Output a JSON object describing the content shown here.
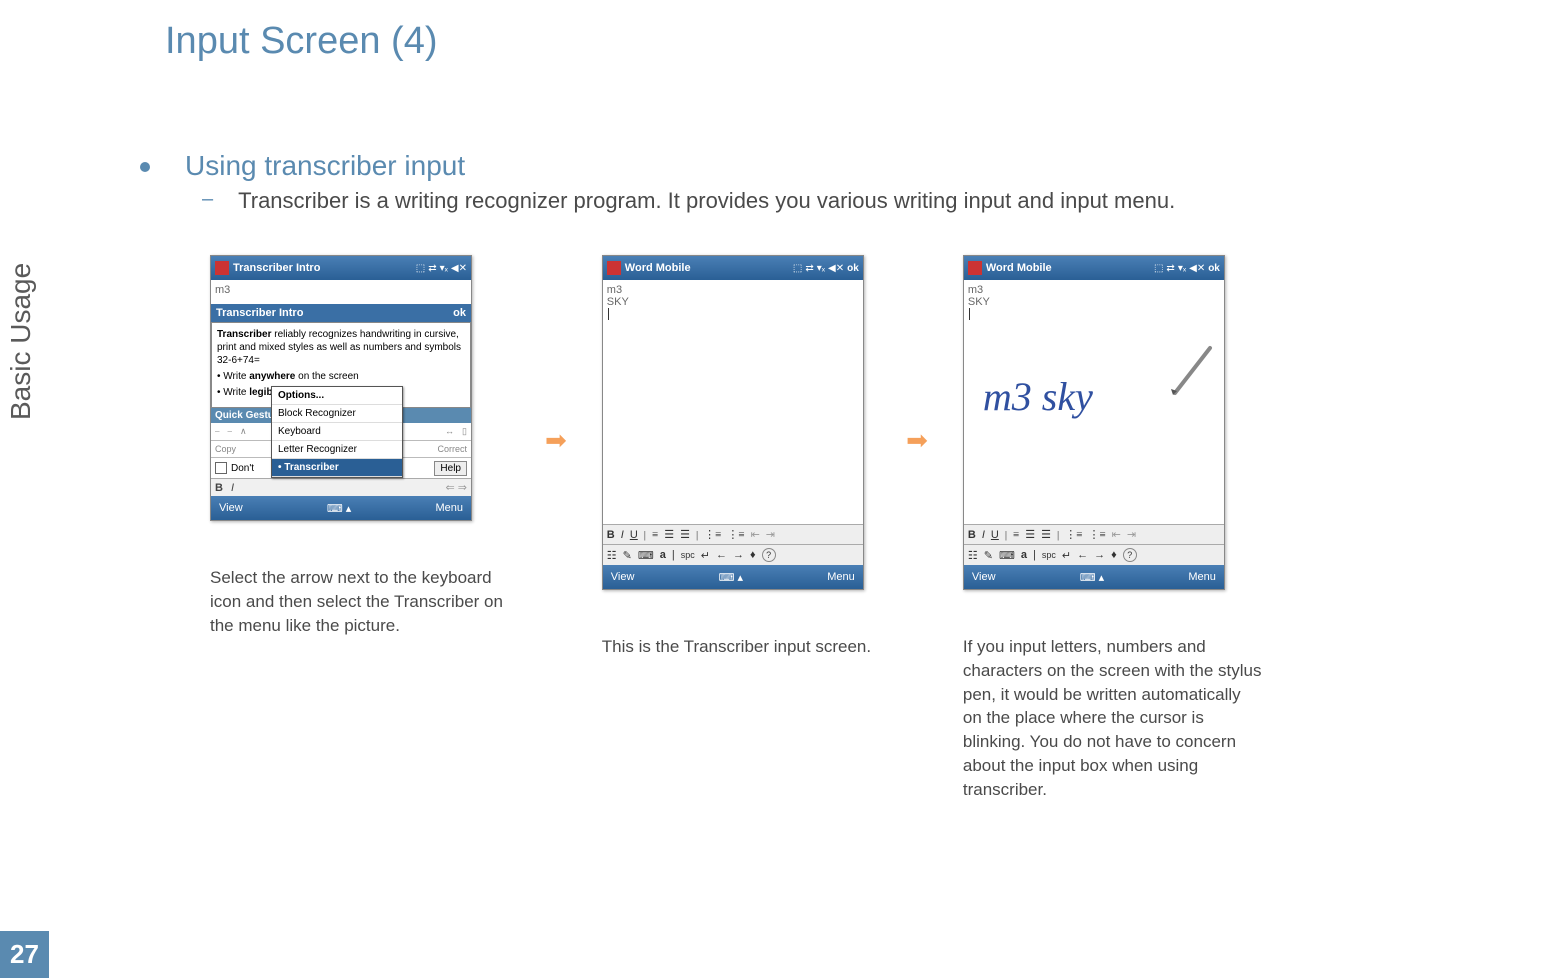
{
  "page": {
    "title": "Input Screen (4)",
    "section_label": "Basic Usage",
    "page_number": "27"
  },
  "bullets": {
    "main": "Using transcriber input",
    "sub": "Transcriber is a writing recognizer program. It provides you various writing input and input menu."
  },
  "screenshots": {
    "s1": {
      "title": "Transcriber Intro",
      "status_ok": "ok",
      "body_top": "m3",
      "intro_title": "Transcriber Intro",
      "intro_text_bold": "Transcriber",
      "intro_text_rest": " reliably recognizes handwriting in cursive, print and mixed styles as well as numbers and symbols 32-6+74=",
      "intro_tip1_pre": "Write ",
      "intro_tip1_bold": "anywhere",
      "intro_tip1_post": " on the screen",
      "intro_tip2_pre": "Write ",
      "intro_tip2_bold": "legibly",
      "quick_title": "Quick Gestures",
      "gest_copy": "Copy",
      "gest_correct": "Correct",
      "dont": "Don't",
      "help_label": "Help",
      "menu": {
        "options": "Options...",
        "block": "Block Recognizer",
        "keyboard": "Keyboard",
        "letter": "Letter Recognizer",
        "transcriber": "Transcriber"
      },
      "bi_b": "B",
      "bi_i": "I",
      "bot_view": "View",
      "bot_menu": "Menu",
      "caption": "Select the arrow next to the keyboard icon and then select the Transcriber on the menu like the picture."
    },
    "s2": {
      "title": "Word Mobile",
      "status_ok": "ok",
      "body_line1": "m3",
      "body_line2": "SKY",
      "fmt_b": "B",
      "fmt_i": "I",
      "fmt_u": "U",
      "trans_a": "a",
      "trans_spc": "spc",
      "help_q": "?",
      "bot_view": "View",
      "bot_menu": "Menu",
      "caption": "This is the Transcriber input screen."
    },
    "s3": {
      "title": "Word Mobile",
      "status_ok": "ok",
      "body_line1": "m3",
      "body_line2": "SKY",
      "handwritten": "m3 sky",
      "fmt_b": "B",
      "fmt_i": "I",
      "fmt_u": "U",
      "trans_a": "a",
      "trans_spc": "spc",
      "help_q": "?",
      "bot_view": "View",
      "bot_menu": "Menu",
      "caption": "If you input  letters, numbers and characters on the screen with the stylus pen, it would be written automatically on the place where the cursor is blinking. You do not have to concern about the input  box when using transcriber."
    }
  }
}
